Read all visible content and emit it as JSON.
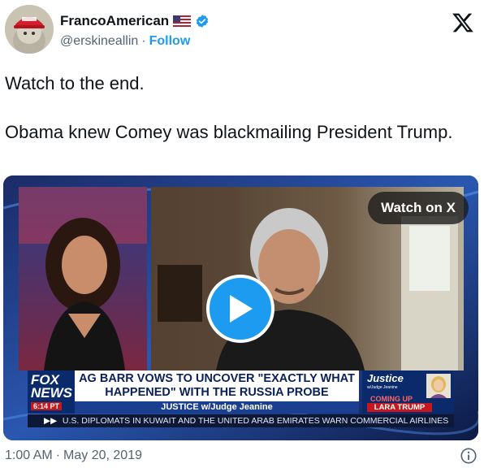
{
  "author": {
    "display_name": "FrancoAmerican",
    "handle": "@erskineallin",
    "separator": "·",
    "follow_label": "Follow",
    "flag_icon": "us-flag-icon",
    "verified_icon": "verified-badge-icon"
  },
  "header": {
    "logo_icon": "x-logo-icon"
  },
  "tweet": {
    "text": "Watch to the end.\n\nObama knew Comey was blackmailing President Trump."
  },
  "media": {
    "watch_label": "Watch on X",
    "play_icon": "play-icon",
    "chyron": {
      "network": "FOX NEWS",
      "time": "6:14 PT",
      "headline": "AG BARR VOWS TO UNCOVER \"EXACTLY WHAT HAPPENED\" WITH THE RUSSIA PROBE",
      "show": "JUSTICE w/Judge Jeanine",
      "side_title": "Justice",
      "side_sub": "w/Judge Jeanine",
      "coming_up": "COMING UP",
      "coming_up_name": "LARA TRUMP",
      "ticker_arrows": "▶▶",
      "ticker": "U.S. DIPLOMATS IN KUWAIT AND THE UNITED ARAB EMIRATES WARN COMMERCIAL AIRLINES"
    }
  },
  "footer": {
    "time": "1:00 AM",
    "separator": "·",
    "date": "May 20, 2019",
    "info_icon": "info-icon"
  },
  "colors": {
    "link_blue": "#1d9bf0",
    "secondary_text": "#536471",
    "primary_text": "#0f1419",
    "fox_blue": "#0b2a6b",
    "fox_red": "#c6171e"
  }
}
